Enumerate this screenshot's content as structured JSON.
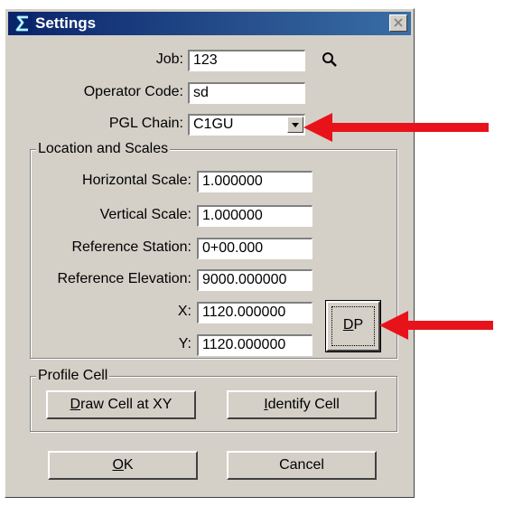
{
  "window": {
    "title": "Settings",
    "icon": "app-s-icon",
    "close_label": "✕"
  },
  "fields": {
    "job_label": "Job:",
    "job_value": "123",
    "operator_label": "Operator Code:",
    "operator_value": "sd",
    "pgl_label": "PGL Chain:",
    "pgl_value": "C1GU"
  },
  "location": {
    "group_title": "Location and Scales",
    "hscale_label": "Horizontal Scale:",
    "hscale_value": "1.000000",
    "vscale_label": "Vertical Scale:",
    "vscale_value": "1.000000",
    "refsta_label": "Reference Station:",
    "refsta_value": "0+00.000",
    "refelev_label": "Reference Elevation:",
    "refelev_value": "9000.000000",
    "x_label": "X:",
    "x_value": "1120.000000",
    "y_label": "Y:",
    "y_value": "1120.000000",
    "dp_mnemonic": "D",
    "dp_rest": "P"
  },
  "profile": {
    "group_title": "Profile Cell",
    "draw_mnemonic": "D",
    "draw_rest": "raw Cell at XY",
    "identify_mnemonic": "I",
    "identify_rest": "dentify Cell"
  },
  "footer": {
    "ok_mnemonic": "O",
    "ok_rest": "K",
    "cancel_label": "Cancel"
  },
  "colors": {
    "arrow": "#e8131a",
    "titlebar_start": "#0a246a",
    "titlebar_end": "#3a6ea5",
    "dialog_bg": "#d4d0c8"
  }
}
